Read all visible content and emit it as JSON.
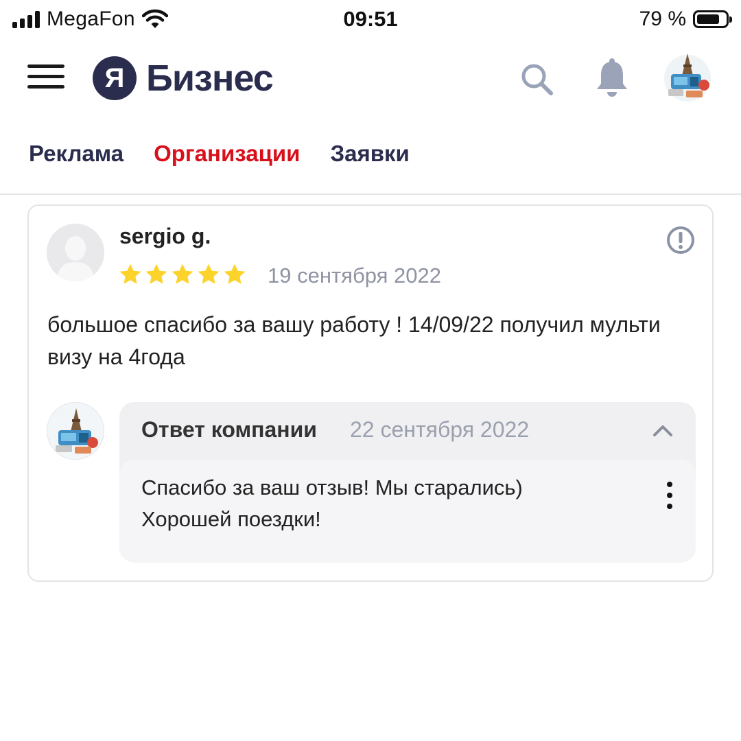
{
  "status_bar": {
    "carrier": "MegaFon",
    "time": "09:51",
    "battery_percent": "79 %",
    "battery_level": 0.79,
    "icons": [
      "signal-icon",
      "wifi-icon",
      "battery-icon"
    ]
  },
  "header": {
    "logo_letter": "Я",
    "logo_text": "Бизнес",
    "icons": [
      "menu-icon",
      "search-icon",
      "bell-icon",
      "avatar"
    ]
  },
  "tabs": [
    {
      "label": "Реклама",
      "active": false
    },
    {
      "label": "Организации",
      "active": true
    },
    {
      "label": "Заявки",
      "active": false
    }
  ],
  "review": {
    "author": "sergio g.",
    "rating": 5,
    "date": "19 сентября 2022",
    "text": "большое спасибо за вашу работу ! 14/09/22 получил мульти визу на 4года",
    "reply": {
      "title": "Ответ компании",
      "date": "22 сентября 2022",
      "text_line1": "Спасибо за ваш отзыв! Мы старались)",
      "text_line2": "Хорошей поездки!"
    }
  },
  "colors": {
    "brand_dark": "#2b2d4e",
    "active_tab": "#d8101c",
    "star": "#fcd32b",
    "muted_text": "#8f93a3",
    "reply_bg": "#f0f0f2"
  }
}
